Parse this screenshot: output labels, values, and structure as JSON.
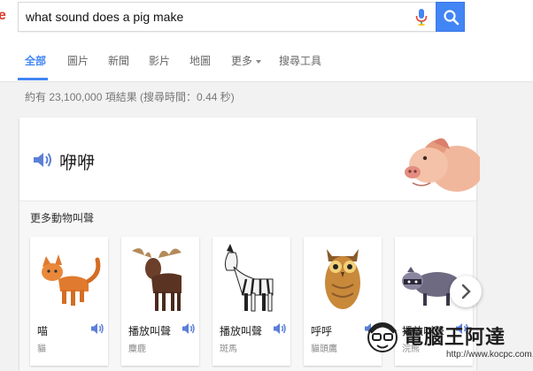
{
  "search": {
    "query": "what sound does a pig make"
  },
  "tabs": [
    {
      "label": "全部"
    },
    {
      "label": "圖片"
    },
    {
      "label": "新聞"
    },
    {
      "label": "影片"
    },
    {
      "label": "地圖"
    },
    {
      "label": "更多"
    },
    {
      "label": "搜尋工具"
    }
  ],
  "stats": "約有 23,100,000 項結果 (搜尋時間：0.44 秒)",
  "answer": {
    "sound_word": "咿咿"
  },
  "more_animals": {
    "title": "更多動物叫聲",
    "items": [
      {
        "sound": "喵",
        "name": "貓",
        "icon": "cat-icon"
      },
      {
        "sound": "播放叫聲",
        "name": "麋鹿",
        "icon": "moose-icon"
      },
      {
        "sound": "播放叫聲",
        "name": "斑馬",
        "icon": "zebra-icon"
      },
      {
        "sound": "呼呼",
        "name": "貓頭鷹",
        "icon": "owl-icon"
      },
      {
        "sound": "播放叫聲",
        "name": "浣熊",
        "icon": "raccoon-icon"
      }
    ]
  },
  "watermark": {
    "text": "電腦王阿達",
    "url": "http://www.kocpc.com.tw"
  },
  "colors": {
    "accent": "#4285f4",
    "speaker": "#5b7fd8"
  }
}
